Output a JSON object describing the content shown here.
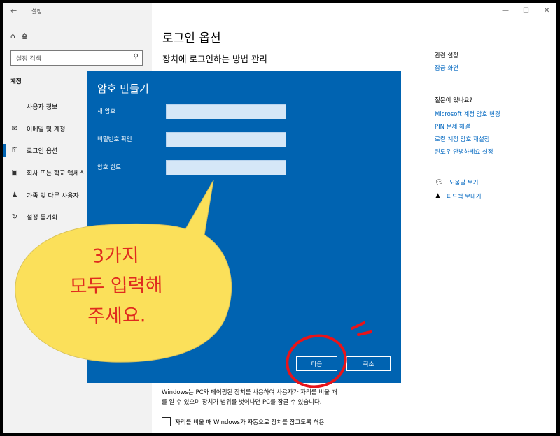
{
  "window": {
    "app_title": "설정",
    "minimize": "—",
    "maximize": "☐",
    "close": "✕"
  },
  "sidebar": {
    "back": "←",
    "home_label": "홈",
    "search_placeholder": "설정 검색",
    "section_title": "계정",
    "items": [
      {
        "label": "사용자 정보",
        "icon": "person-card-icon",
        "glyph": "⚌"
      },
      {
        "label": "이메일 및 계정",
        "icon": "mail-icon",
        "glyph": "✉"
      },
      {
        "label": "로그인 옵션",
        "icon": "key-icon",
        "glyph": "⚿",
        "active": true
      },
      {
        "label": "회사 또는 학교 액세스",
        "icon": "briefcase-icon",
        "glyph": "▣"
      },
      {
        "label": "가족 및 다른 사용자",
        "icon": "people-icon",
        "glyph": "♟"
      },
      {
        "label": "설정 동기화",
        "icon": "sync-icon",
        "glyph": "↻"
      }
    ]
  },
  "main": {
    "title": "로그인 옵션",
    "subtitle": "장치에 로그인하는 방법 관리",
    "related": {
      "heading": "관련 설정",
      "links": [
        "잠금 화면"
      ]
    },
    "questions": {
      "heading": "질문이 있나요?",
      "links": [
        "Microsoft 계정 암호 변경",
        "PIN 문제 해결",
        "로컬 계정 암호 재설정",
        "윈도우 안녕하세요 설정"
      ]
    },
    "help": {
      "get_help": "도움말 보기",
      "feedback": "피드백 보내기"
    },
    "description_line1": "Windows는 PC와 페어링된 장치를 사용하여 사용자가 자리를 비울 때",
    "description_line2": "를 알 수 있으며 장치가 범위를 벗어나면 PC를 잠글 수 있습니다.",
    "checkbox_label": "자리를 비울 때 Windows가 자동으로 장치를 잠그도록 허용"
  },
  "dialog": {
    "title": "암호 만들기",
    "fields": [
      {
        "label": "새 암호",
        "value": ""
      },
      {
        "label": "비밀번호 확인",
        "value": ""
      },
      {
        "label": "암호 힌트",
        "value": ""
      }
    ],
    "next_button": "다음",
    "cancel_button": "취소"
  },
  "annotation": {
    "lines": [
      "3가지",
      "모두 입력해",
      "주세요."
    ],
    "bubble_color": "#fbe05a",
    "text_color": "#e02a1e",
    "circle_color": "#e8141a"
  }
}
